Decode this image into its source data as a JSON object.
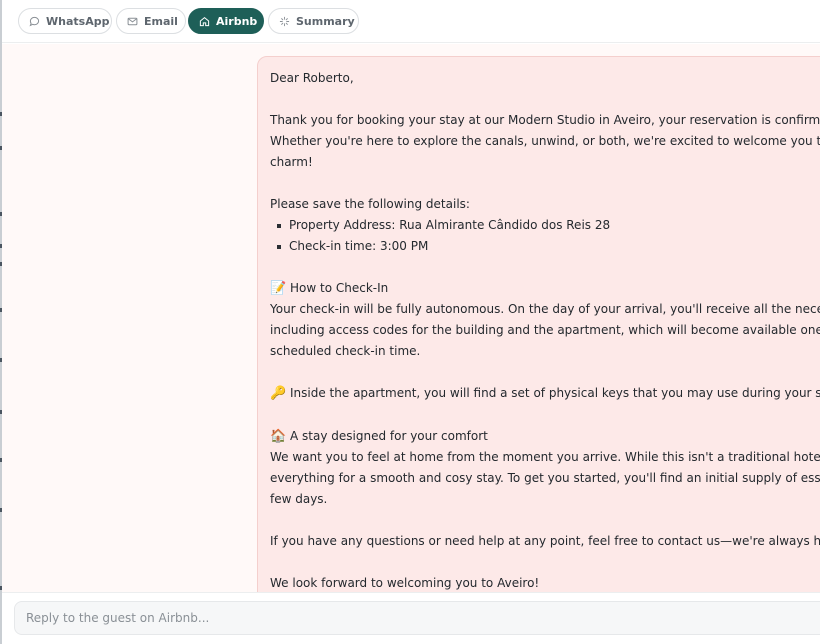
{
  "tabs": [
    {
      "label": "WhatsApp",
      "icon": "chat-bubble-icon",
      "active": false
    },
    {
      "label": "Email",
      "icon": "mail-icon",
      "active": false
    },
    {
      "label": "Airbnb",
      "icon": "home-icon",
      "active": true
    },
    {
      "label": "Summary",
      "icon": "sparkle-icon",
      "active": false
    }
  ],
  "message": {
    "greeting": "Dear Roberto,",
    "intro_line1": "Thank you for booking your stay at our Modern Studio in Aveiro, your reservation is confirmed",
    "intro_line2": "Whether you're here to explore the canals, unwind, or both, we're excited to welcome you to",
    "intro_line3": "charm!",
    "save_details": "Please save the following details:",
    "details": [
      "Property Address: Rua Almirante Cândido dos Reis 28",
      "Check-in time: 3:00 PM"
    ],
    "checkin_emoji": "📝",
    "checkin_heading": "How to Check-In",
    "checkin_line1": "Your check-in will be fully autonomous. On the day of your arrival, you'll receive all the neces",
    "checkin_line2": "including access codes for the building and the apartment, which will become available one",
    "checkin_line3": "scheduled check-in time.",
    "keys_emoji": "🔑",
    "keys_text": "Inside the apartment, you will find a set of physical keys that you may use during your stay",
    "comfort_emoji": "🏠",
    "comfort_heading": "A stay designed for your comfort",
    "comfort_line1": "We want you to feel at home from the moment you arrive. While this isn't a traditional hotel, w",
    "comfort_line2": "everything for a smooth and cosy stay. To get you started, you'll find an initial supply of esse",
    "comfort_line3": "few days.",
    "questions": "If you have any questions or need help at any point, feel free to contact us—we're always her",
    "closing": "We look forward to welcoming you to Aveiro!"
  },
  "reply": {
    "placeholder": "Reply to the guest on Airbnb..."
  },
  "colors": {
    "accent": "#1e5f58",
    "bubble_bg": "#fde9e8",
    "chat_bg": "#fff9f8"
  }
}
